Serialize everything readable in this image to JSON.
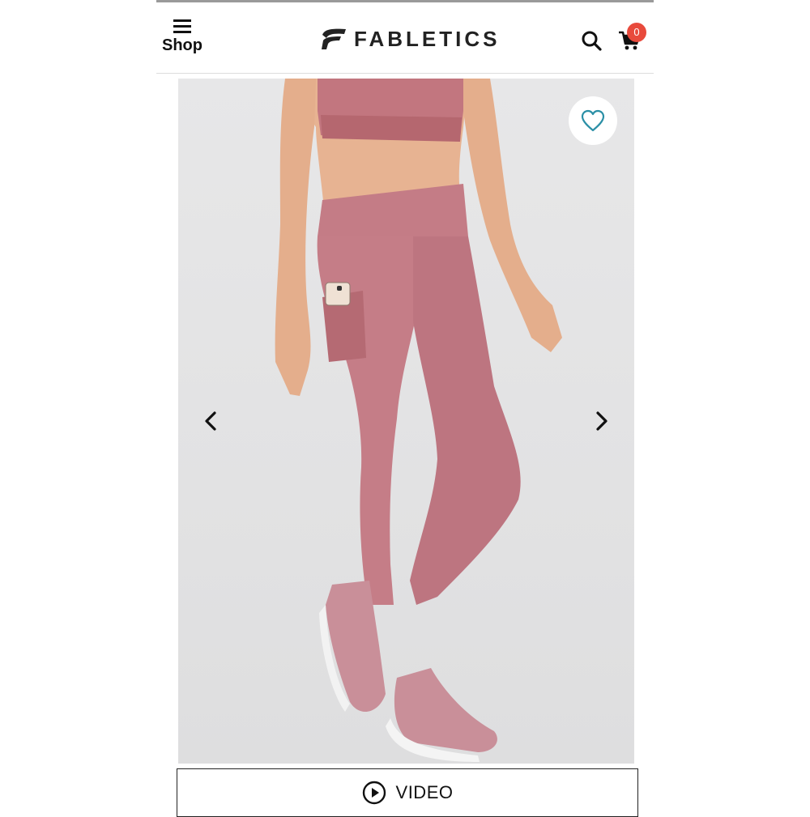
{
  "header": {
    "shop_label": "Shop",
    "brand_name": "FABLETICS",
    "cart_count": "0"
  },
  "product": {
    "image_alt": "Pink high-waisted leggings with side phone pocket",
    "prev_icon": "chevron-left-icon",
    "next_icon": "chevron-right-icon",
    "favorite_icon": "heart-outline-icon"
  },
  "video": {
    "label": "VIDEO"
  },
  "colors": {
    "accent_teal": "#2a8fa6",
    "badge_red": "#e84a3c",
    "legging_pink": "#c9828c"
  }
}
